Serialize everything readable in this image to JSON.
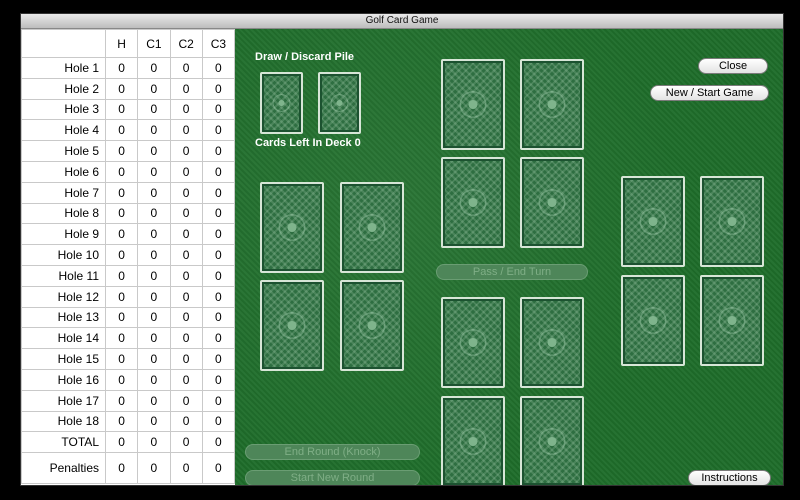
{
  "window": {
    "title": "Golf Card Game"
  },
  "score": {
    "headers": [
      "",
      "H",
      "C1",
      "C2",
      "C3"
    ],
    "rows": [
      {
        "label": "Hole 1",
        "vals": [
          "0",
          "0",
          "0",
          "0"
        ]
      },
      {
        "label": "Hole 2",
        "vals": [
          "0",
          "0",
          "0",
          "0"
        ]
      },
      {
        "label": "Hole 3",
        "vals": [
          "0",
          "0",
          "0",
          "0"
        ]
      },
      {
        "label": "Hole 4",
        "vals": [
          "0",
          "0",
          "0",
          "0"
        ]
      },
      {
        "label": "Hole 5",
        "vals": [
          "0",
          "0",
          "0",
          "0"
        ]
      },
      {
        "label": "Hole 6",
        "vals": [
          "0",
          "0",
          "0",
          "0"
        ]
      },
      {
        "label": "Hole 7",
        "vals": [
          "0",
          "0",
          "0",
          "0"
        ]
      },
      {
        "label": "Hole 8",
        "vals": [
          "0",
          "0",
          "0",
          "0"
        ]
      },
      {
        "label": "Hole 9",
        "vals": [
          "0",
          "0",
          "0",
          "0"
        ]
      },
      {
        "label": "Hole 10",
        "vals": [
          "0",
          "0",
          "0",
          "0"
        ]
      },
      {
        "label": "Hole 11",
        "vals": [
          "0",
          "0",
          "0",
          "0"
        ]
      },
      {
        "label": "Hole 12",
        "vals": [
          "0",
          "0",
          "0",
          "0"
        ]
      },
      {
        "label": "Hole 13",
        "vals": [
          "0",
          "0",
          "0",
          "0"
        ]
      },
      {
        "label": "Hole 14",
        "vals": [
          "0",
          "0",
          "0",
          "0"
        ]
      },
      {
        "label": "Hole 15",
        "vals": [
          "0",
          "0",
          "0",
          "0"
        ]
      },
      {
        "label": "Hole 16",
        "vals": [
          "0",
          "0",
          "0",
          "0"
        ]
      },
      {
        "label": "Hole 17",
        "vals": [
          "0",
          "0",
          "0",
          "0"
        ]
      },
      {
        "label": "Hole 18",
        "vals": [
          "0",
          "0",
          "0",
          "0"
        ]
      },
      {
        "label": "TOTAL",
        "vals": [
          "0",
          "0",
          "0",
          "0"
        ]
      }
    ],
    "penalties": {
      "label": "Penalties",
      "vals": [
        "0",
        "0",
        "0",
        "0"
      ]
    }
  },
  "felt": {
    "draw_discard_label": "Draw / Discard Pile",
    "cards_left_label": "Cards Left In Deck 0"
  },
  "buttons": {
    "close": "Close",
    "new_start": "New / Start Game",
    "pass_end_turn": "Pass / End Turn",
    "end_round": "End Round (Knock)",
    "start_new_round": "Start New Round",
    "instructions": "Instructions"
  },
  "colors": {
    "felt": "#1f6e2b",
    "card_back": "#2e6e41"
  }
}
